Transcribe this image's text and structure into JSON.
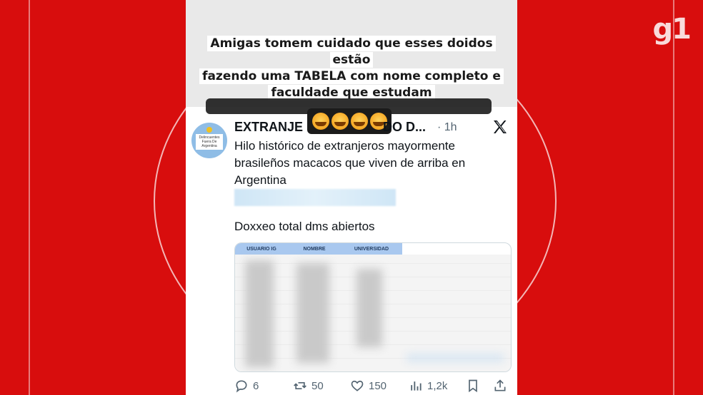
{
  "brand": {
    "logo_text": "g1"
  },
  "story": {
    "caption_lines": [
      "Amigas tomem cuidado que esses doidos estão",
      "fazendo uma TABELA com nome completo e",
      "faculdade que estudam"
    ]
  },
  "tweet": {
    "handle": "EXTRANJE",
    "handle_tail": "DO D...",
    "time": "· 1h",
    "avatar_text": "Delincuentes Fuera De Argentina",
    "text": "Hilo histórico de extranjeros mayormente brasileños macacos que viven de arriba en Argentina",
    "second_text": "Doxxeo total dms abiertos",
    "table_headers": [
      "USUARIO IG",
      "NOMBRE",
      "UNIVERSIDAD"
    ]
  },
  "actions": {
    "replies": "6",
    "reposts": "50",
    "likes": "150",
    "views": "1,2k"
  },
  "icons": [
    "x-logo-icon",
    "reply-icon",
    "repost-icon",
    "like-icon",
    "views-icon",
    "bookmark-icon",
    "share-icon"
  ]
}
